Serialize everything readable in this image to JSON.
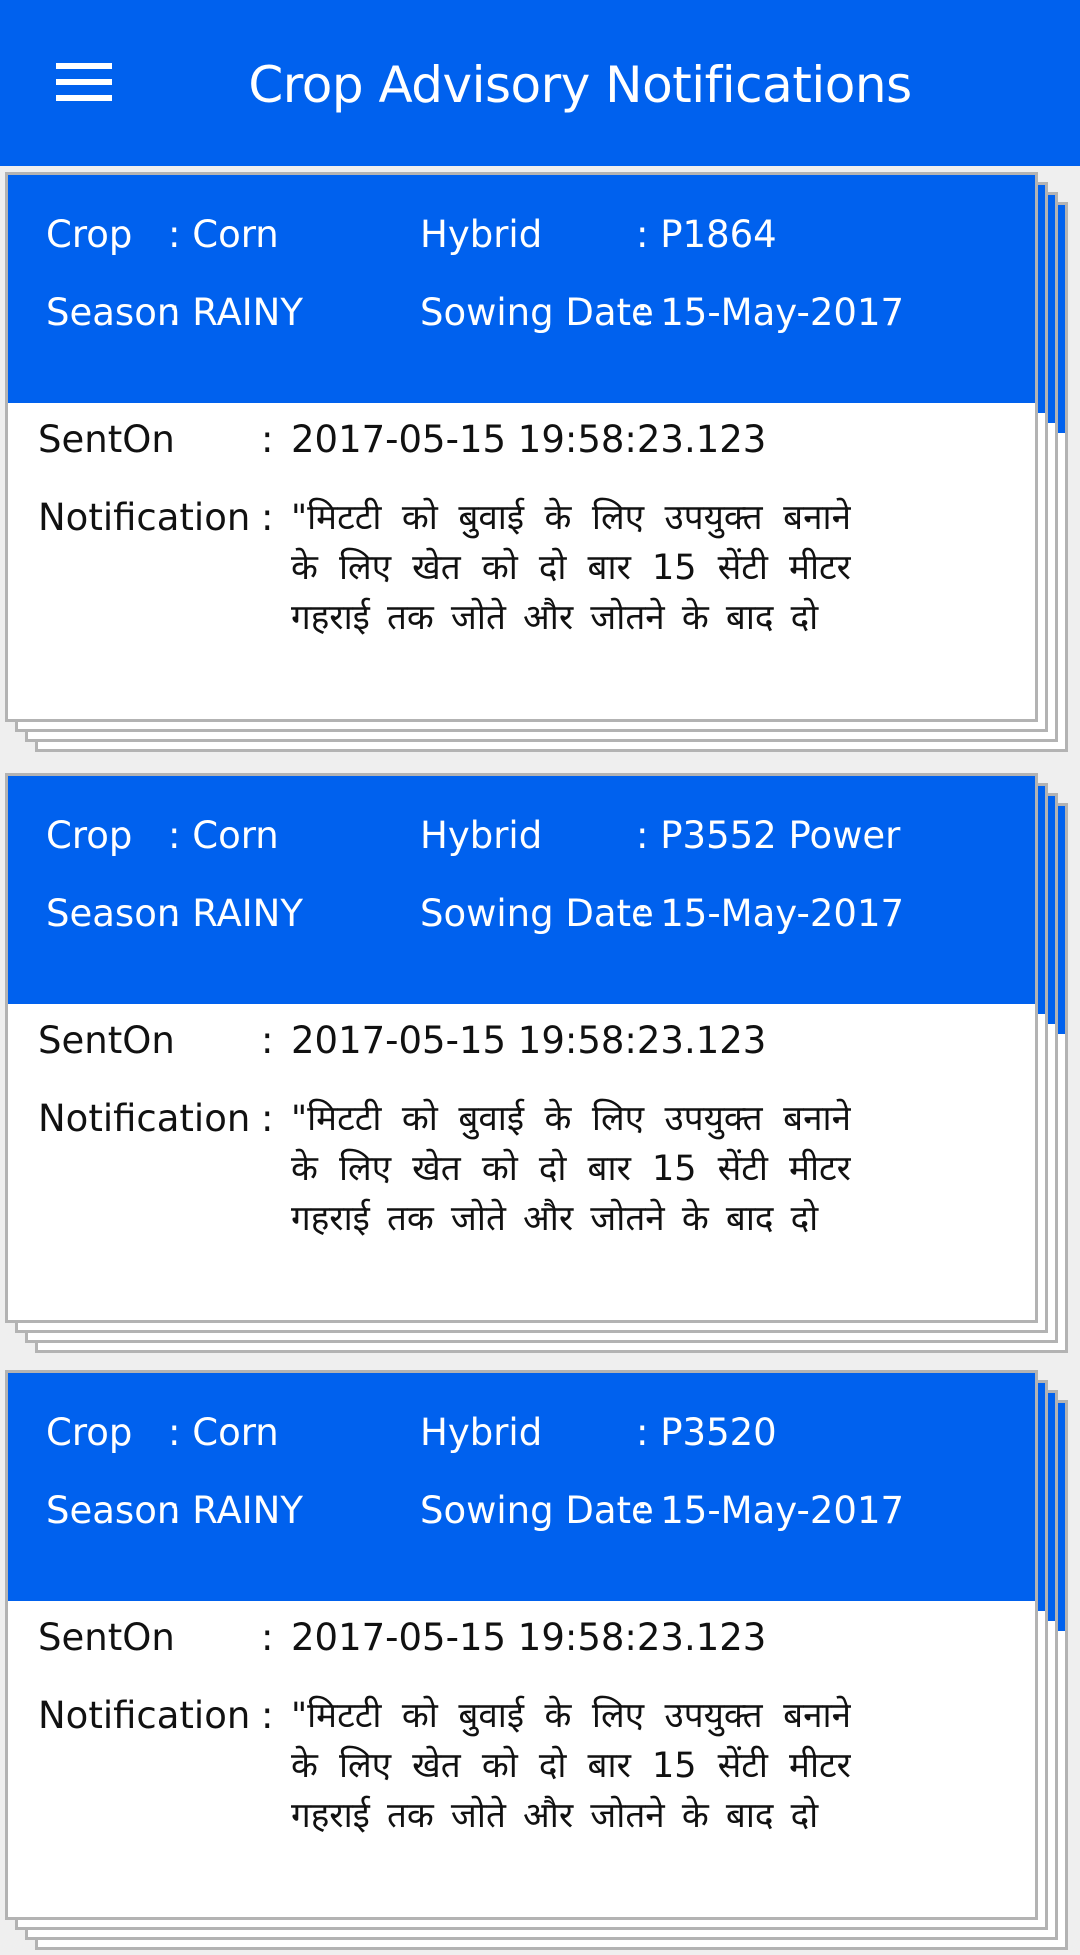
{
  "app_bar": {
    "menu_icon": "hamburger-menu-icon",
    "title": "Crop Advisory Notifications"
  },
  "colors": {
    "primary": "#0061EE",
    "background": "#EFEFEF",
    "card_border": "#B3B3B3"
  },
  "labels": {
    "crop": "Crop",
    "season": "Season",
    "hybrid": "Hybrid",
    "sowing_date": "Sowing Date",
    "sent_on": "SentOn",
    "notification": "Notification",
    "separator": ":"
  },
  "cards": [
    {
      "crop": "Corn",
      "season": "RAINY",
      "hybrid": "P1864",
      "sowing_date": "15-May-2017",
      "sent_on": "2017-05-15 19:58:23.123",
      "notification": "\"मिटटी को बुवाई के लिए उपयुक्त बनाने के लिए खेत को दो बार 15 सेंटी मीटर गहराई तक जोते और जोतने के बाद दो"
    },
    {
      "crop": "Corn",
      "season": "RAINY",
      "hybrid": "P3552 Power",
      "sowing_date": "15-May-2017",
      "sent_on": "2017-05-15 19:58:23.123",
      "notification": "\"मिटटी को बुवाई के लिए उपयुक्त बनाने के लिए खेत को दो बार 15 सेंटी मीटर गहराई तक जोते और जोतने के बाद दो"
    },
    {
      "crop": "Corn",
      "season": "RAINY",
      "hybrid": "P3520",
      "sowing_date": "15-May-2017",
      "sent_on": "2017-05-15 19:58:23.123",
      "notification": "\"मिटटी को बुवाई के लिए उपयुक्त बनाने के लिए खेत को दो बार 15 सेंटी मीटर गहराई तक जोते और जोतने के बाद दो"
    }
  ]
}
